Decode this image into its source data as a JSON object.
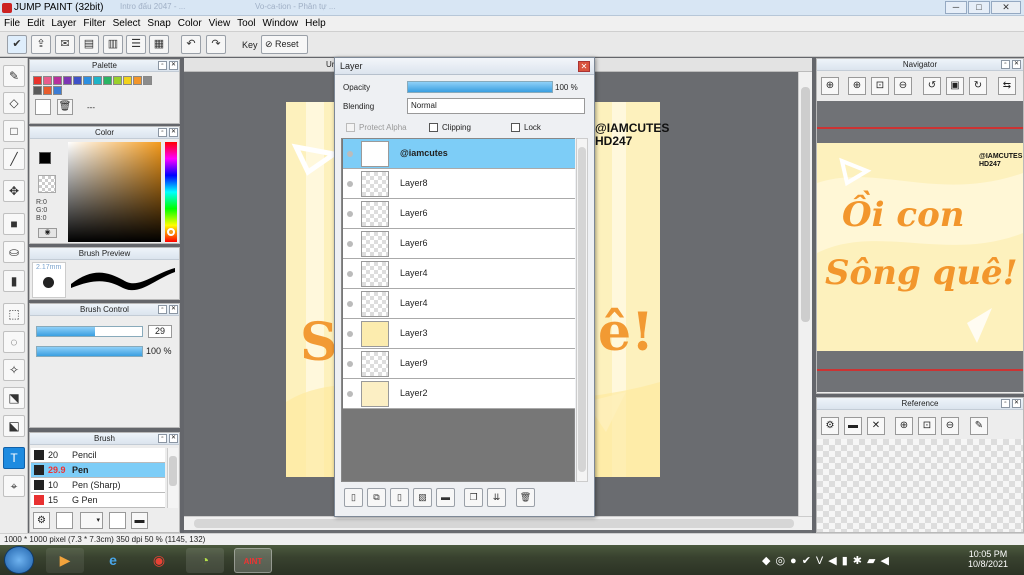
{
  "app": {
    "title": "JUMP PAINT (32bit)",
    "background_tabs": [
      "Intro đấu 2047 - ...",
      "Vo-ca-tion - Phân tự ... "
    ],
    "window_buttons": [
      "─",
      "□",
      "✕"
    ]
  },
  "menu": [
    "File",
    "Edit",
    "Layer",
    "Filter",
    "Select",
    "Snap",
    "Color",
    "View",
    "Tool",
    "Window",
    "Help"
  ],
  "toolbar": {
    "key_label": "Key",
    "reset_label": "Reset"
  },
  "palette": {
    "title": "Palette",
    "empty_label": "---",
    "swatches": [
      "#e8322c",
      "#e85c8c",
      "#b8309c",
      "#7d36b4",
      "#3e52c8",
      "#2d8fe0",
      "#20b4c8",
      "#2bb464",
      "#9bd02c",
      "#f2d21c",
      "#f2962c",
      "#8c8c8c",
      "#5a5a5a",
      "#e85c2c",
      "#3c7cd4"
    ]
  },
  "color": {
    "title": "Color",
    "r_label": "R:0",
    "g_label": "G:0",
    "b_label": "B:0",
    "foreground": "#000000",
    "background": "#ffffff"
  },
  "brush_preview": {
    "title": "Brush Preview",
    "size_label": "2.17mm"
  },
  "brush_control": {
    "title": "Brush Control",
    "size_value": "29",
    "size_fill": 0.55,
    "opacity_value": "100 %",
    "opacity_fill": 1.0
  },
  "brush": {
    "title": "Brush",
    "items": [
      {
        "size": "20",
        "name": "Pencil",
        "color": "#222222",
        "selected": false
      },
      {
        "size": "29.9",
        "name": "Pen",
        "color": "#222222",
        "selected": true
      },
      {
        "size": "10",
        "name": "Pen (Sharp)",
        "color": "#222222",
        "selected": false
      },
      {
        "size": "15",
        "name": "G Pen",
        "color": "#e83030",
        "selected": false
      }
    ]
  },
  "canvas": {
    "tab_label": "Ur",
    "art_handle": "@IAMCUTES\nHD247",
    "art_text_line1": "Ồi con",
    "art_text_line2": "Sông quê!"
  },
  "layer": {
    "title": "Layer",
    "opacity_label": "Opacity",
    "opacity_value": "100 %",
    "opacity_fill": 1.0,
    "blending_label": "Blending",
    "blending_value": "Normal",
    "protect_alpha_label": "Protect Alpha",
    "clipping_label": "Clipping",
    "lock_label": "Lock",
    "layers": [
      {
        "name": "@iamcutes",
        "selected": true
      },
      {
        "name": "Layer8",
        "selected": false
      },
      {
        "name": "Layer6",
        "selected": false
      },
      {
        "name": "Layer6",
        "selected": false
      },
      {
        "name": "Layer4",
        "selected": false
      },
      {
        "name": "Layer4",
        "selected": false
      },
      {
        "name": "Layer3",
        "selected": false
      },
      {
        "name": "Layer9",
        "selected": false
      },
      {
        "name": "Layer2",
        "selected": false
      }
    ]
  },
  "navigator": {
    "title": "Navigator",
    "preview_handle": "@IAMCUTES\nHD247",
    "preview_line1": "Ồi con",
    "preview_line2": "Sông quê!"
  },
  "reference": {
    "title": "Reference"
  },
  "status": {
    "text": "1000 * 1000 pixel   (7.3 * 7.3cm)   350 dpi   50 %   (1145, 132)"
  },
  "taskbar": {
    "time": "10:05 PM",
    "date": "10/8/2021",
    "jump_label": "AINT"
  },
  "colors": {
    "accent": "#1e8be0",
    "layer_selected": "#7dcdf7",
    "art_orange": "#f2962c",
    "art_bg": "#fdf1bd"
  }
}
